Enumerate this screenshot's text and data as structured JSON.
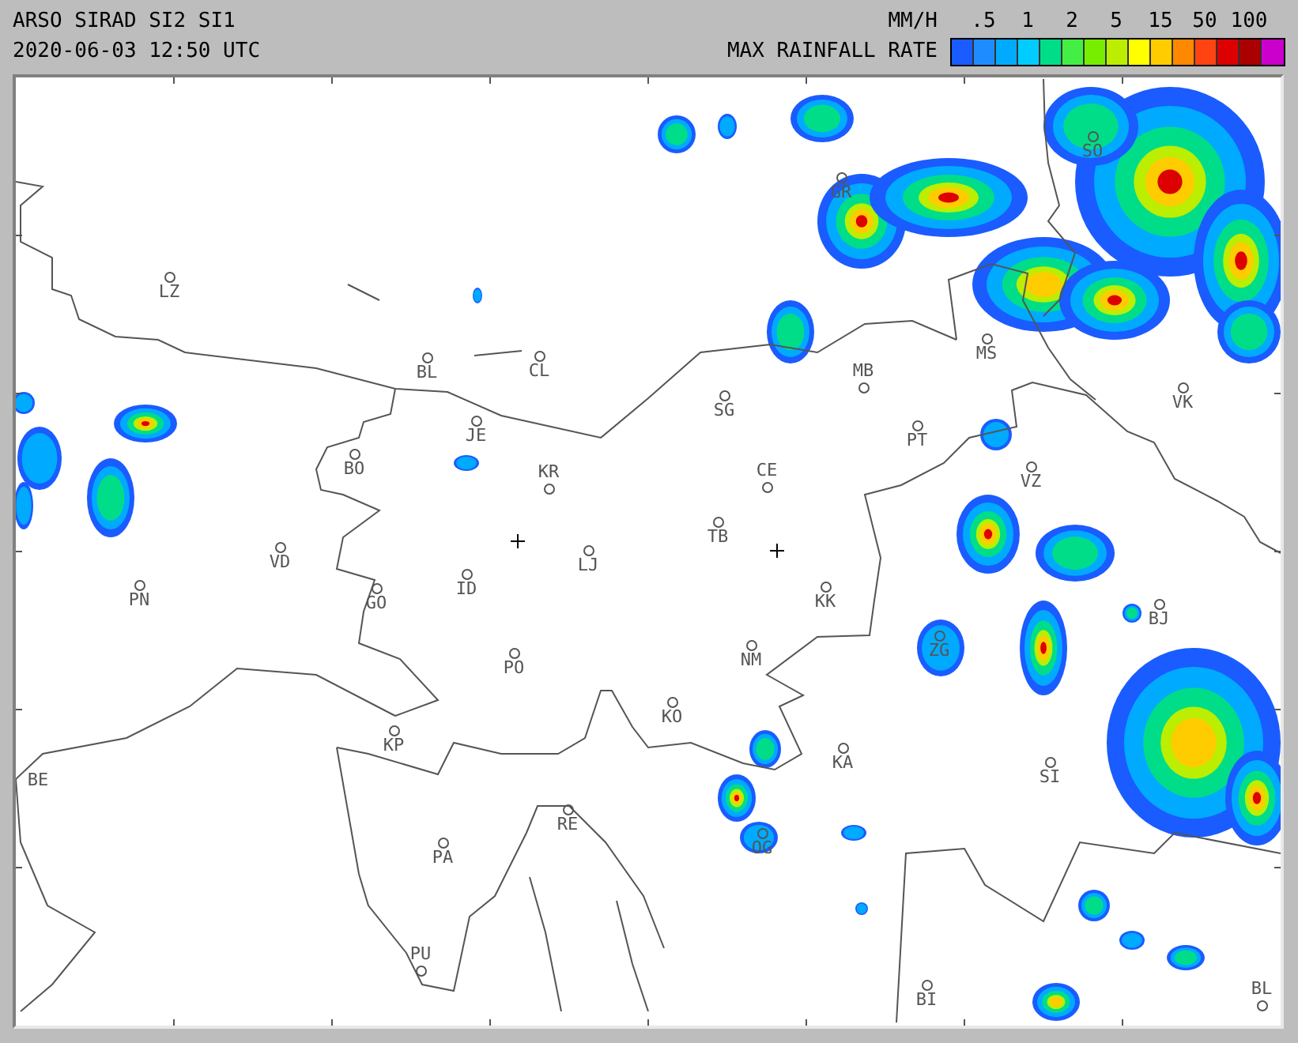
{
  "header": {
    "title": "ARSO SIRAD SI2 SI1",
    "timestamp": "2020-06-03 12:50 UTC"
  },
  "legend": {
    "unit": "MM/H",
    "title": "MAX RAINFALL RATE",
    "ticks": [
      ".5",
      "1",
      "2",
      "5",
      "15",
      "50",
      "100"
    ],
    "colors": [
      {
        "color": "#1a5cff"
      },
      {
        "color": "#1e8cff"
      },
      {
        "color": "#00aaff"
      },
      {
        "color": "#00ccff"
      },
      {
        "color": "#00dd88"
      },
      {
        "color": "#44ee44"
      },
      {
        "color": "#77ee00"
      },
      {
        "color": "#bbee00"
      },
      {
        "color": "#ffff00"
      },
      {
        "color": "#ffcc00"
      },
      {
        "color": "#ff8800"
      },
      {
        "color": "#ff4411"
      },
      {
        "color": "#dd0000"
      },
      {
        "color": "#aa0000"
      },
      {
        "color": "#cc00cc"
      }
    ]
  },
  "map": {
    "places": [
      {
        "label": "SO"
      },
      {
        "label": "GR"
      },
      {
        "label": "LZ"
      },
      {
        "label": "MS"
      },
      {
        "label": "BL"
      },
      {
        "label": "CL"
      },
      {
        "label": "MB"
      },
      {
        "label": "SG"
      },
      {
        "label": "VK"
      },
      {
        "label": "JE"
      },
      {
        "label": "PT"
      },
      {
        "label": "BO"
      },
      {
        "label": "KR"
      },
      {
        "label": "CE"
      },
      {
        "label": "VZ"
      },
      {
        "label": "TB"
      },
      {
        "label": "VD"
      },
      {
        "label": "LJ"
      },
      {
        "label": "PN"
      },
      {
        "label": "GO"
      },
      {
        "label": "ID"
      },
      {
        "label": "KK"
      },
      {
        "label": "BJ"
      },
      {
        "label": "PO"
      },
      {
        "label": "NM"
      },
      {
        "label": "ZG"
      },
      {
        "label": "KO"
      },
      {
        "label": "KP"
      },
      {
        "label": "BE"
      },
      {
        "label": "KA"
      },
      {
        "label": "SI"
      },
      {
        "label": "RE"
      },
      {
        "label": "PA"
      },
      {
        "label": "OG"
      },
      {
        "label": "PU"
      },
      {
        "label": "BI"
      },
      {
        "label": "BL"
      }
    ]
  }
}
